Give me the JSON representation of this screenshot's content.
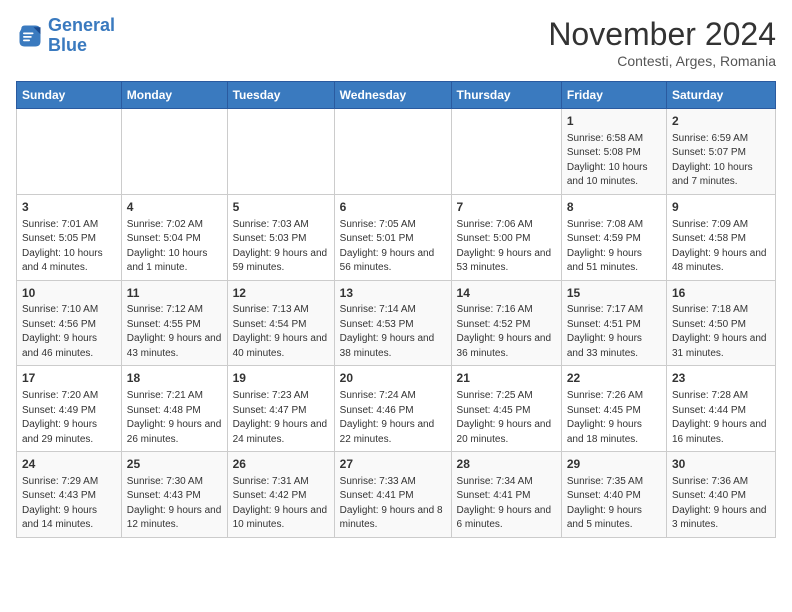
{
  "logo": {
    "line1": "General",
    "line2": "Blue"
  },
  "title": "November 2024",
  "subtitle": "Contesti, Arges, Romania",
  "days_of_week": [
    "Sunday",
    "Monday",
    "Tuesday",
    "Wednesday",
    "Thursday",
    "Friday",
    "Saturday"
  ],
  "weeks": [
    [
      {
        "day": "",
        "info": ""
      },
      {
        "day": "",
        "info": ""
      },
      {
        "day": "",
        "info": ""
      },
      {
        "day": "",
        "info": ""
      },
      {
        "day": "",
        "info": ""
      },
      {
        "day": "1",
        "info": "Sunrise: 6:58 AM\nSunset: 5:08 PM\nDaylight: 10 hours and 10 minutes."
      },
      {
        "day": "2",
        "info": "Sunrise: 6:59 AM\nSunset: 5:07 PM\nDaylight: 10 hours and 7 minutes."
      }
    ],
    [
      {
        "day": "3",
        "info": "Sunrise: 7:01 AM\nSunset: 5:05 PM\nDaylight: 10 hours and 4 minutes."
      },
      {
        "day": "4",
        "info": "Sunrise: 7:02 AM\nSunset: 5:04 PM\nDaylight: 10 hours and 1 minute."
      },
      {
        "day": "5",
        "info": "Sunrise: 7:03 AM\nSunset: 5:03 PM\nDaylight: 9 hours and 59 minutes."
      },
      {
        "day": "6",
        "info": "Sunrise: 7:05 AM\nSunset: 5:01 PM\nDaylight: 9 hours and 56 minutes."
      },
      {
        "day": "7",
        "info": "Sunrise: 7:06 AM\nSunset: 5:00 PM\nDaylight: 9 hours and 53 minutes."
      },
      {
        "day": "8",
        "info": "Sunrise: 7:08 AM\nSunset: 4:59 PM\nDaylight: 9 hours and 51 minutes."
      },
      {
        "day": "9",
        "info": "Sunrise: 7:09 AM\nSunset: 4:58 PM\nDaylight: 9 hours and 48 minutes."
      }
    ],
    [
      {
        "day": "10",
        "info": "Sunrise: 7:10 AM\nSunset: 4:56 PM\nDaylight: 9 hours and 46 minutes."
      },
      {
        "day": "11",
        "info": "Sunrise: 7:12 AM\nSunset: 4:55 PM\nDaylight: 9 hours and 43 minutes."
      },
      {
        "day": "12",
        "info": "Sunrise: 7:13 AM\nSunset: 4:54 PM\nDaylight: 9 hours and 40 minutes."
      },
      {
        "day": "13",
        "info": "Sunrise: 7:14 AM\nSunset: 4:53 PM\nDaylight: 9 hours and 38 minutes."
      },
      {
        "day": "14",
        "info": "Sunrise: 7:16 AM\nSunset: 4:52 PM\nDaylight: 9 hours and 36 minutes."
      },
      {
        "day": "15",
        "info": "Sunrise: 7:17 AM\nSunset: 4:51 PM\nDaylight: 9 hours and 33 minutes."
      },
      {
        "day": "16",
        "info": "Sunrise: 7:18 AM\nSunset: 4:50 PM\nDaylight: 9 hours and 31 minutes."
      }
    ],
    [
      {
        "day": "17",
        "info": "Sunrise: 7:20 AM\nSunset: 4:49 PM\nDaylight: 9 hours and 29 minutes."
      },
      {
        "day": "18",
        "info": "Sunrise: 7:21 AM\nSunset: 4:48 PM\nDaylight: 9 hours and 26 minutes."
      },
      {
        "day": "19",
        "info": "Sunrise: 7:23 AM\nSunset: 4:47 PM\nDaylight: 9 hours and 24 minutes."
      },
      {
        "day": "20",
        "info": "Sunrise: 7:24 AM\nSunset: 4:46 PM\nDaylight: 9 hours and 22 minutes."
      },
      {
        "day": "21",
        "info": "Sunrise: 7:25 AM\nSunset: 4:45 PM\nDaylight: 9 hours and 20 minutes."
      },
      {
        "day": "22",
        "info": "Sunrise: 7:26 AM\nSunset: 4:45 PM\nDaylight: 9 hours and 18 minutes."
      },
      {
        "day": "23",
        "info": "Sunrise: 7:28 AM\nSunset: 4:44 PM\nDaylight: 9 hours and 16 minutes."
      }
    ],
    [
      {
        "day": "24",
        "info": "Sunrise: 7:29 AM\nSunset: 4:43 PM\nDaylight: 9 hours and 14 minutes."
      },
      {
        "day": "25",
        "info": "Sunrise: 7:30 AM\nSunset: 4:43 PM\nDaylight: 9 hours and 12 minutes."
      },
      {
        "day": "26",
        "info": "Sunrise: 7:31 AM\nSunset: 4:42 PM\nDaylight: 9 hours and 10 minutes."
      },
      {
        "day": "27",
        "info": "Sunrise: 7:33 AM\nSunset: 4:41 PM\nDaylight: 9 hours and 8 minutes."
      },
      {
        "day": "28",
        "info": "Sunrise: 7:34 AM\nSunset: 4:41 PM\nDaylight: 9 hours and 6 minutes."
      },
      {
        "day": "29",
        "info": "Sunrise: 7:35 AM\nSunset: 4:40 PM\nDaylight: 9 hours and 5 minutes."
      },
      {
        "day": "30",
        "info": "Sunrise: 7:36 AM\nSunset: 4:40 PM\nDaylight: 9 hours and 3 minutes."
      }
    ]
  ]
}
